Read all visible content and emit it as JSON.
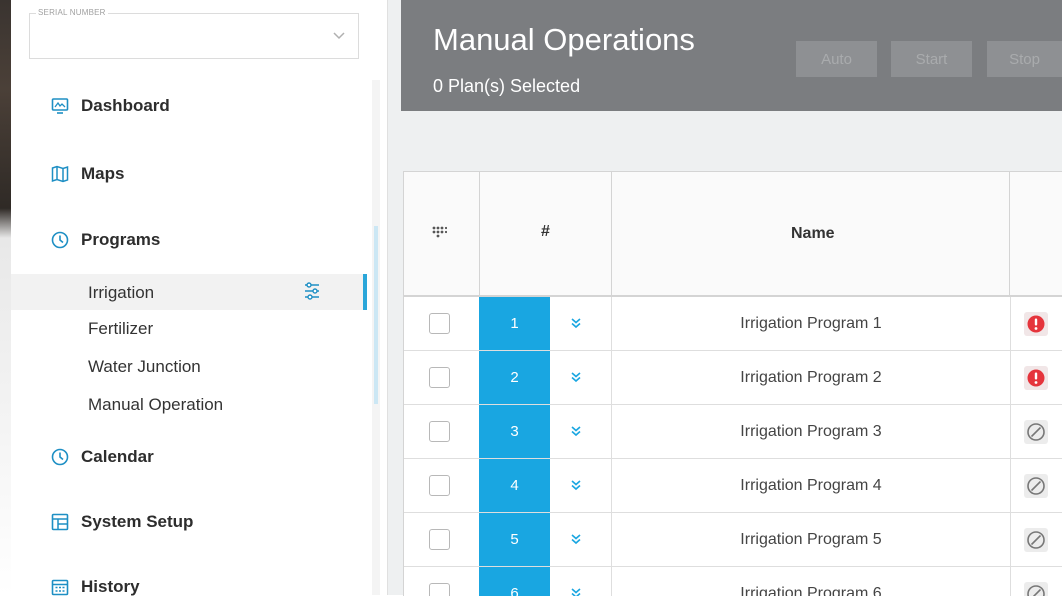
{
  "sidebar": {
    "serial": {
      "label": "SERIAL NUMBER",
      "value": ""
    },
    "nav": {
      "dashboard": "Dashboard",
      "maps": "Maps",
      "programs": "Programs",
      "calendar": "Calendar",
      "system_setup": "System Setup",
      "history": "History"
    },
    "programs_sub": {
      "irrigation": "Irrigation",
      "fertilizer": "Fertilizer",
      "water_junction": "Water Junction",
      "manual_operation": "Manual Operation"
    },
    "active_item": "Irrigation"
  },
  "header": {
    "title": "Manual Operations",
    "subtitle": "0 Plan(s) Selected",
    "buttons": {
      "auto": "Auto",
      "start": "Start",
      "stop": "Stop"
    }
  },
  "table": {
    "columns": {
      "number": "#",
      "name": "Name"
    },
    "rows": [
      {
        "num": "1",
        "name": "Irrigation Program 1",
        "status": "error"
      },
      {
        "num": "2",
        "name": "Irrigation Program 2",
        "status": "error"
      },
      {
        "num": "3",
        "name": "Irrigation Program 3",
        "status": "disabled"
      },
      {
        "num": "4",
        "name": "Irrigation Program 4",
        "status": "disabled"
      },
      {
        "num": "5",
        "name": "Irrigation Program 5",
        "status": "disabled"
      },
      {
        "num": "6",
        "name": "Irrigation Program 6",
        "status": "disabled"
      }
    ]
  },
  "colors": {
    "accent": "#19a6e1",
    "header_bg": "#7b7d80",
    "error": "#e5343c"
  }
}
